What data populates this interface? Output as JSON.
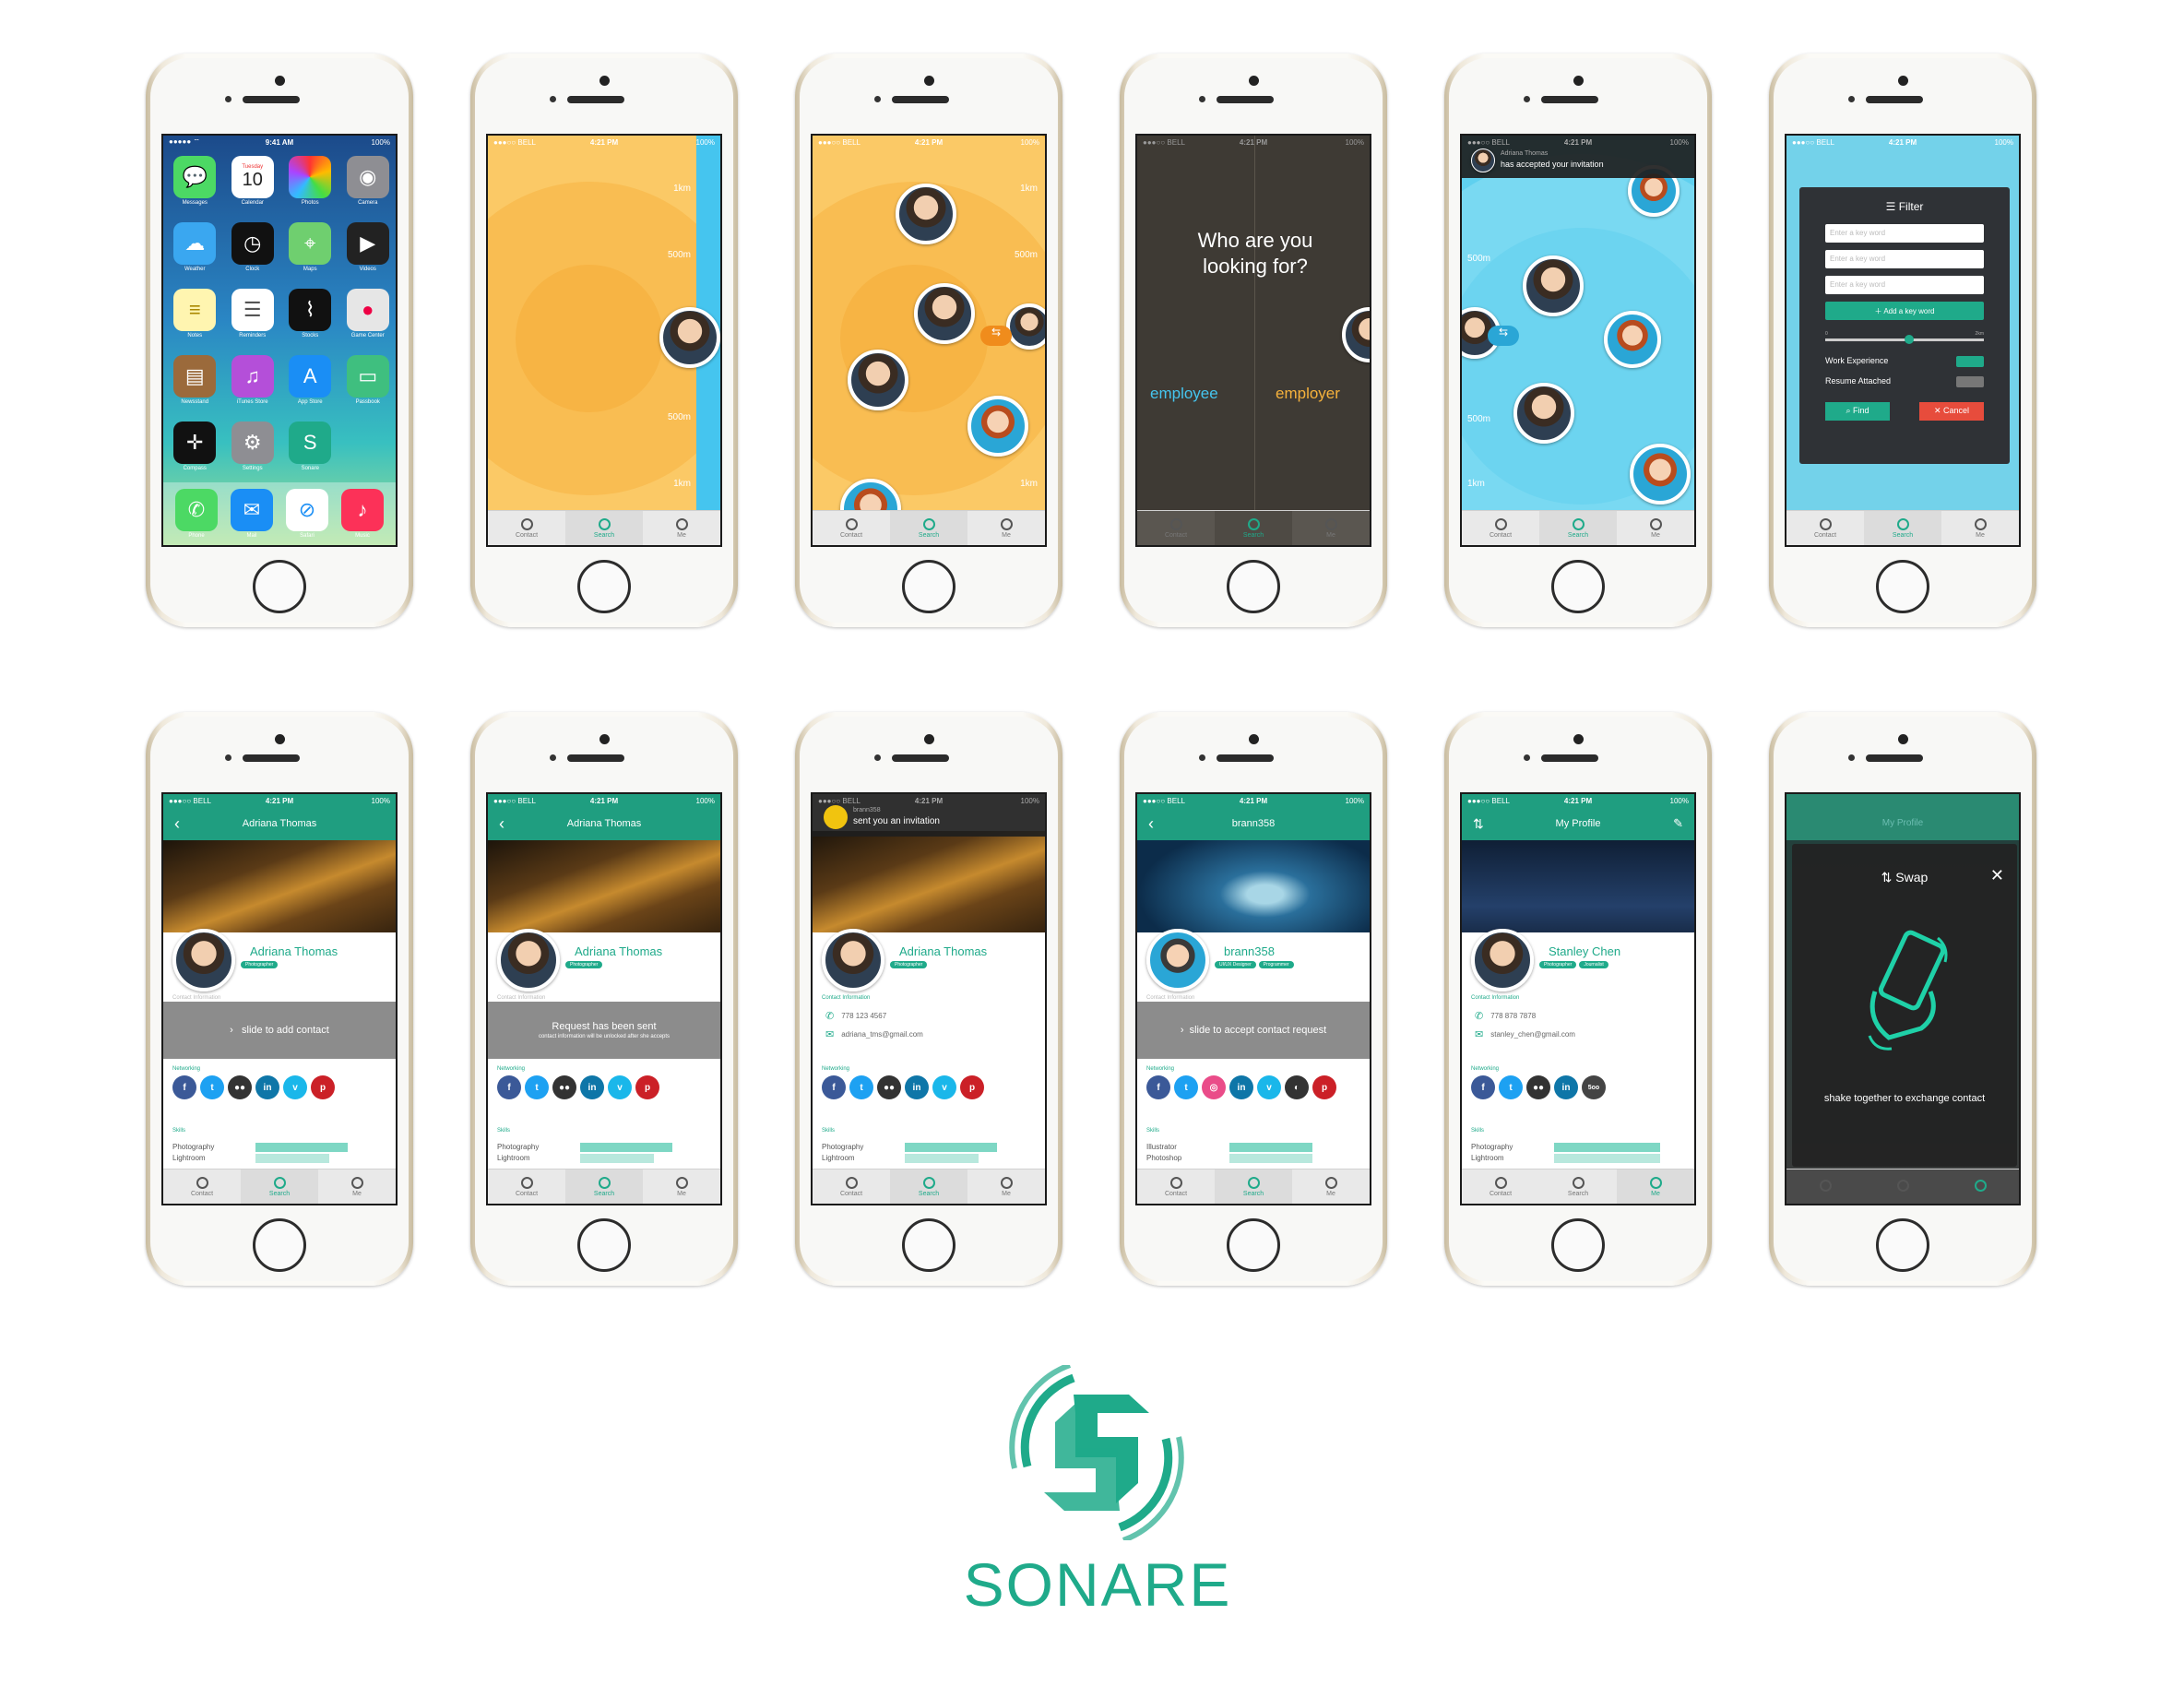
{
  "status": {
    "carrier": "BELL",
    "time": "4:21 PM",
    "battery": "100%",
    "home_time": "9:41 AM"
  },
  "tabs": [
    "Contact",
    "Search",
    "Me"
  ],
  "home_apps": [
    "Messages",
    "Calendar",
    "Photos",
    "Camera",
    "Weather",
    "Clock",
    "Maps",
    "Videos",
    "Notes",
    "Reminders",
    "Stocks",
    "Game Center",
    "Newsstand",
    "iTunes Store",
    "App Store",
    "Passbook",
    "Compass",
    "Settings",
    "Sonare",
    ""
  ],
  "home_calendar": {
    "day": "Tuesday",
    "date": "10"
  },
  "dock": [
    "Phone",
    "Mail",
    "Safari",
    "Music"
  ],
  "radar": {
    "labels": [
      "1km",
      "500m",
      "500m",
      "1km"
    ]
  },
  "who": {
    "question": "Who are you looking for?",
    "left": "employee",
    "right": "employer"
  },
  "invite_accepted": {
    "name": "Adriana Thomas",
    "text": "has accepted your invitation"
  },
  "radar_blue": {
    "labels": [
      "500m",
      "500m",
      "1km"
    ]
  },
  "filter": {
    "title": "Filter",
    "placeholders": [
      "Enter a key word",
      "Enter a key word",
      "Enter a key word"
    ],
    "add": "Add a key word",
    "range_min": "0",
    "range_max": "2km",
    "work": "Work Experience",
    "resume": "Resume Attached",
    "find": "Find",
    "cancel": "Cancel"
  },
  "p1": {
    "title": "Adriana Thomas",
    "name": "Adriana Thomas",
    "tag": "Photographer",
    "ghost": "Contact Information",
    "bar": "slide to add contact"
  },
  "p2": {
    "title": "Adriana Thomas",
    "name": "Adriana Thomas",
    "tag": "Photographer",
    "ghost": "Contact Information",
    "bar": "Request has been sent",
    "bar_sub": "contact information will be unlocked after she accepts"
  },
  "p3": {
    "notif_user": "brann358",
    "notif_text": "sent you an invitation",
    "name": "Adriana Thomas",
    "tag": "Photographer",
    "contact_hdr": "Contact Information",
    "phone": "778 123 4567",
    "email": "adriana_tms@gmail.com"
  },
  "p4": {
    "title": "brann358",
    "name": "brann358",
    "tags": [
      "UI/UX Designer",
      "Programmer"
    ],
    "ghost": "Contact Information",
    "bar": "slide to accept contact request",
    "skills": [
      "Illustrator",
      "Photoshop"
    ]
  },
  "p5": {
    "title": "My Profile",
    "name": "Stanley Chen",
    "tags": [
      "Photographer",
      "Journalist"
    ],
    "contact_hdr": "Contact Information",
    "phone": "778 878 7878",
    "email": "stanley_chen@gmail.com"
  },
  "p6": {
    "ghost_title": "My Profile",
    "title": "Swap",
    "text": "shake together to exchange contact"
  },
  "sections": {
    "networking": "Networking",
    "skills": "Skills"
  },
  "skills_default": [
    "Photography",
    "Lightroom"
  ],
  "brand": {
    "name": "SONARE"
  },
  "colors": {
    "teal": "#1faa8a",
    "orange": "#f6b23c",
    "sky": "#5fd0ef",
    "filter_bg": "#2f3236"
  }
}
